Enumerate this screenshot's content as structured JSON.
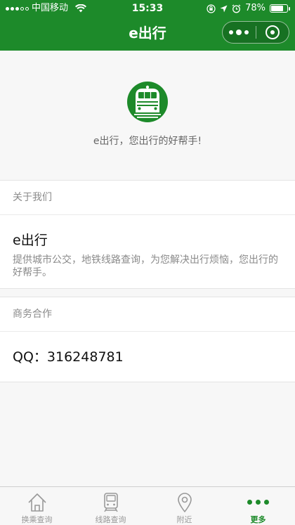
{
  "status_bar": {
    "carrier": "中国移动",
    "time": "15:33",
    "battery_percent": "78%",
    "battery_level": 0.78
  },
  "nav": {
    "title": "e出行",
    "more_icon": "more-dots-icon",
    "close_icon": "target-circle-icon"
  },
  "hero": {
    "logo_icon": "train-logo-icon",
    "tagline": "e出行，您出行的好帮手!"
  },
  "about": {
    "heading": "关于我们",
    "name": "e出行",
    "description": "提供城市公交，地铁线路查询，为您解决出行烦恼，您出行的好帮手。"
  },
  "business": {
    "heading": "商务合作",
    "contact": "QQ：316248781"
  },
  "tabbar": {
    "items": [
      {
        "label": "换乘查询",
        "icon": "home-icon"
      },
      {
        "label": "线路查询",
        "icon": "train-icon"
      },
      {
        "label": "附近",
        "icon": "location-pin-icon"
      },
      {
        "label": "更多",
        "icon": "more-dots-icon"
      }
    ],
    "active_index": 3
  },
  "colors": {
    "brand": "#1d8a2a",
    "background": "#f7f7f7"
  }
}
